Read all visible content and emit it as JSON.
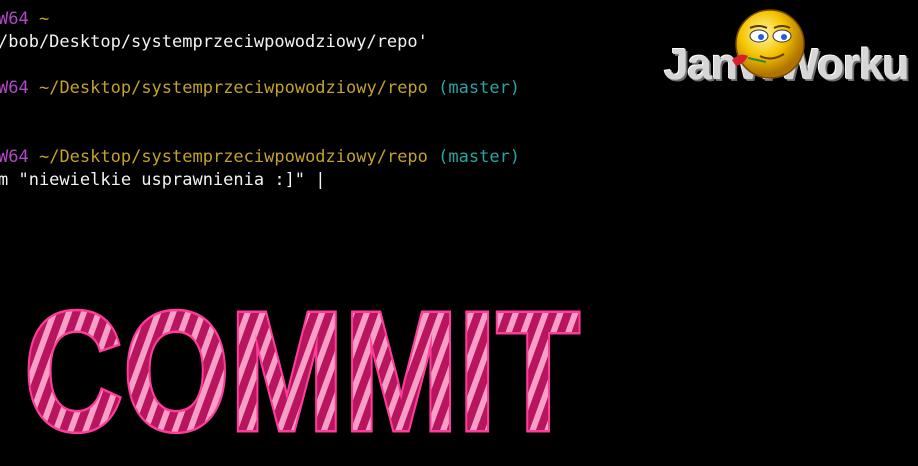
{
  "terminal": {
    "line1": {
      "prefix": "W64",
      "path": "~"
    },
    "line2": {
      "text": "/bob/Desktop/systemprzeciwpowodziowy/repo'"
    },
    "line3": {
      "prefix": "W64",
      "path": "~/Desktop/systemprzeciwpowodziowy/repo",
      "branch": "(master)"
    },
    "line4": {
      "prefix": "W64",
      "path": "~/Desktop/systemprzeciwpowodziowy/repo",
      "branch": "(master)"
    },
    "line5": {
      "text": "m \"niewielkie usprawnienia :]\" |"
    }
  },
  "logo": {
    "text": "JanWWorku",
    "icon": "smiley-icon"
  },
  "banner": {
    "text": "COMMIT"
  },
  "colors": {
    "purple": "#b148c6",
    "yellow": "#c3a228",
    "cyan": "#2aa3a3",
    "banner": "#e0207a"
  }
}
